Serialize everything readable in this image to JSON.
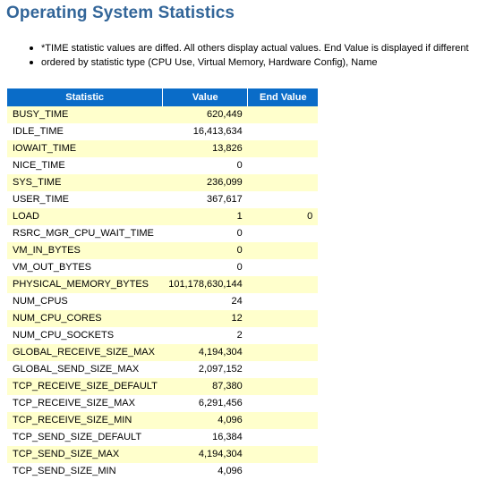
{
  "header": {
    "title": "Operating System Statistics"
  },
  "notes": [
    "*TIME statistic values are diffed. All others display actual values. End Value is displayed if different",
    "ordered by statistic type (CPU Use, Virtual Memory, Hardware Config), Name"
  ],
  "table": {
    "columns": [
      "Statistic",
      "Value",
      "End Value"
    ],
    "header_bg": "#0a6cc8",
    "header_fg": "#ffffff",
    "alt_row_bg": "#ffffcc",
    "row_bg": "#ffffff",
    "rows": [
      {
        "statistic": "BUSY_TIME",
        "value": "620,449",
        "end_value": ""
      },
      {
        "statistic": "IDLE_TIME",
        "value": "16,413,634",
        "end_value": ""
      },
      {
        "statistic": "IOWAIT_TIME",
        "value": "13,826",
        "end_value": ""
      },
      {
        "statistic": "NICE_TIME",
        "value": "0",
        "end_value": ""
      },
      {
        "statistic": "SYS_TIME",
        "value": "236,099",
        "end_value": ""
      },
      {
        "statistic": "USER_TIME",
        "value": "367,617",
        "end_value": ""
      },
      {
        "statistic": "LOAD",
        "value": "1",
        "end_value": "0"
      },
      {
        "statistic": "RSRC_MGR_CPU_WAIT_TIME",
        "value": "0",
        "end_value": ""
      },
      {
        "statistic": "VM_IN_BYTES",
        "value": "0",
        "end_value": ""
      },
      {
        "statistic": "VM_OUT_BYTES",
        "value": "0",
        "end_value": ""
      },
      {
        "statistic": "PHYSICAL_MEMORY_BYTES",
        "value": "101,178,630,144",
        "end_value": ""
      },
      {
        "statistic": "NUM_CPUS",
        "value": "24",
        "end_value": ""
      },
      {
        "statistic": "NUM_CPU_CORES",
        "value": "12",
        "end_value": ""
      },
      {
        "statistic": "NUM_CPU_SOCKETS",
        "value": "2",
        "end_value": ""
      },
      {
        "statistic": "GLOBAL_RECEIVE_SIZE_MAX",
        "value": "4,194,304",
        "end_value": ""
      },
      {
        "statistic": "GLOBAL_SEND_SIZE_MAX",
        "value": "2,097,152",
        "end_value": ""
      },
      {
        "statistic": "TCP_RECEIVE_SIZE_DEFAULT",
        "value": "87,380",
        "end_value": ""
      },
      {
        "statistic": "TCP_RECEIVE_SIZE_MAX",
        "value": "6,291,456",
        "end_value": ""
      },
      {
        "statistic": "TCP_RECEIVE_SIZE_MIN",
        "value": "4,096",
        "end_value": ""
      },
      {
        "statistic": "TCP_SEND_SIZE_DEFAULT",
        "value": "16,384",
        "end_value": ""
      },
      {
        "statistic": "TCP_SEND_SIZE_MAX",
        "value": "4,194,304",
        "end_value": ""
      },
      {
        "statistic": "TCP_SEND_SIZE_MIN",
        "value": "4,096",
        "end_value": ""
      }
    ]
  }
}
